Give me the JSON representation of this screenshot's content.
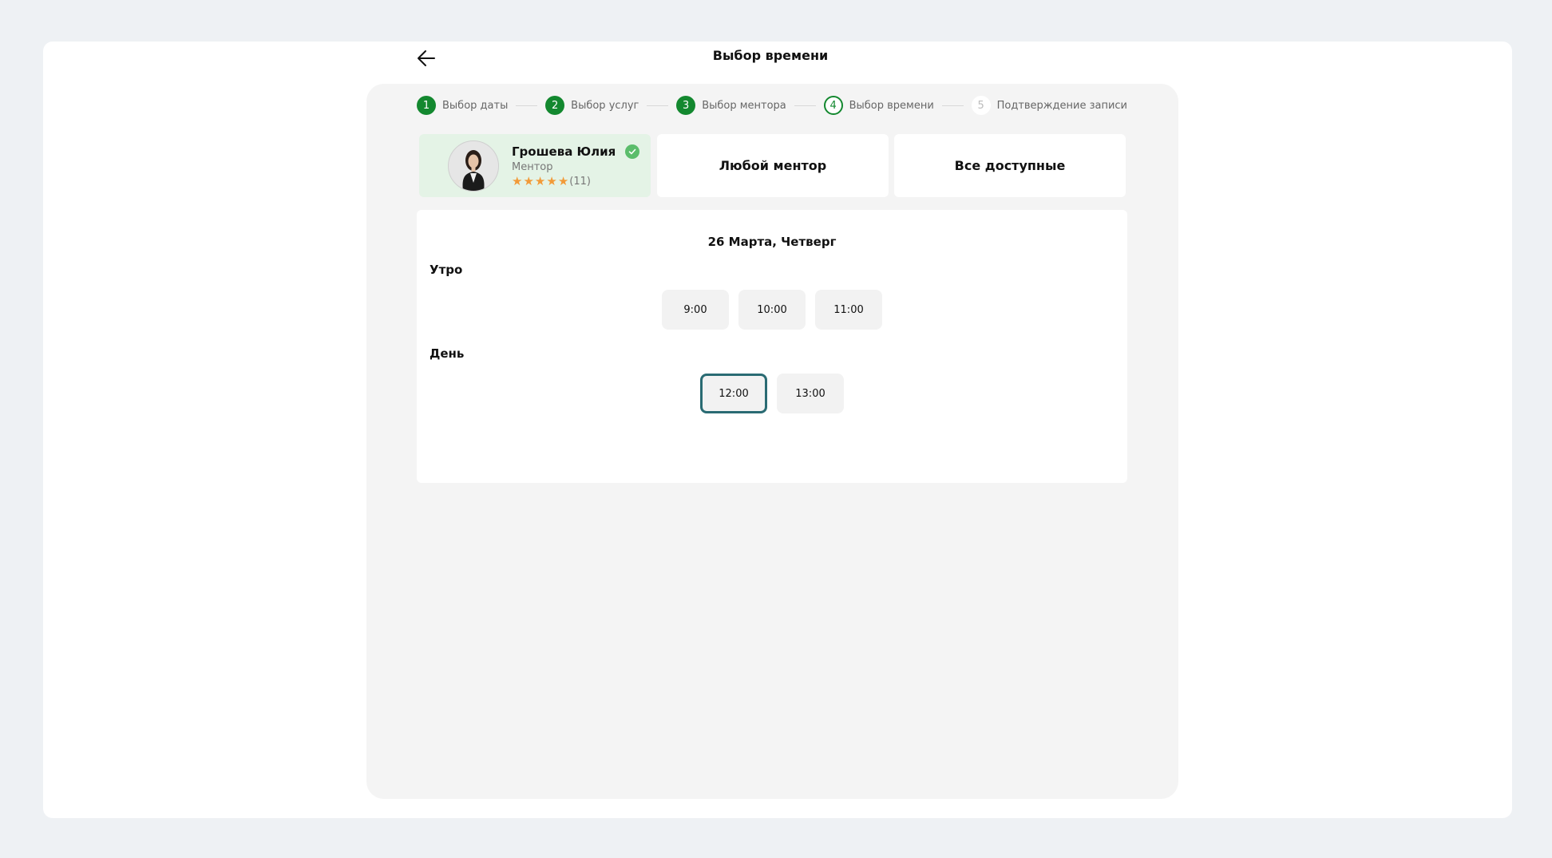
{
  "header": {
    "title": "Выбор времени",
    "back_icon": "arrow-left-icon"
  },
  "stepper": {
    "steps": [
      {
        "num": "1",
        "label": "Выбор даты",
        "state": "done"
      },
      {
        "num": "2",
        "label": "Выбор услуг",
        "state": "done"
      },
      {
        "num": "3",
        "label": "Выбор ментора",
        "state": "done"
      },
      {
        "num": "4",
        "label": "Выбор времени",
        "state": "active"
      },
      {
        "num": "5",
        "label": "Подтверждение записи",
        "state": "future"
      }
    ]
  },
  "mentor": {
    "name": "Грошева Юлия",
    "role": "Ментор",
    "rating_stars": 5,
    "reviews": "(11)",
    "verified": true
  },
  "options": {
    "any_mentor": "Любой ментор",
    "all_available": "Все доступные"
  },
  "schedule": {
    "date": "26 Марта, Четверг",
    "morning": {
      "label": "Утро",
      "slots": [
        "9:00",
        "10:00",
        "11:00"
      ]
    },
    "day": {
      "label": "День",
      "slots": [
        "12:00",
        "13:00"
      ]
    },
    "selected_slot": "12:00"
  },
  "colors": {
    "accent": "#13882f",
    "selected_border": "#2a6b73",
    "star": "#f29a38",
    "selected_card": "#e4f3e6"
  }
}
